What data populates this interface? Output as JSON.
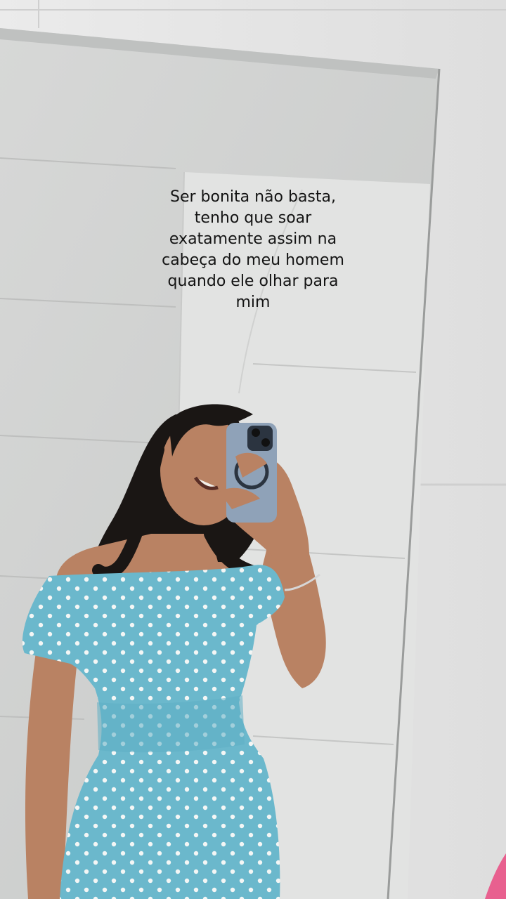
{
  "overlay": {
    "caption": "Ser bonita não basta,\ntenho que soar\nexatamente assim na\ncabeça do meu homem\nquando ele olhar para\nmim"
  },
  "colors": {
    "wall": "#e6e6e6",
    "mirror": "#cfd1d0",
    "dress": "#6bb8cc",
    "dots": "#f4f6f5",
    "hair": "#1a1614",
    "skin": "#b98263",
    "phone_case": "#8fa2b8",
    "text": "#141414"
  },
  "scene": {
    "subject": "mirror-selfie",
    "dress_pattern": "polka-dot"
  }
}
